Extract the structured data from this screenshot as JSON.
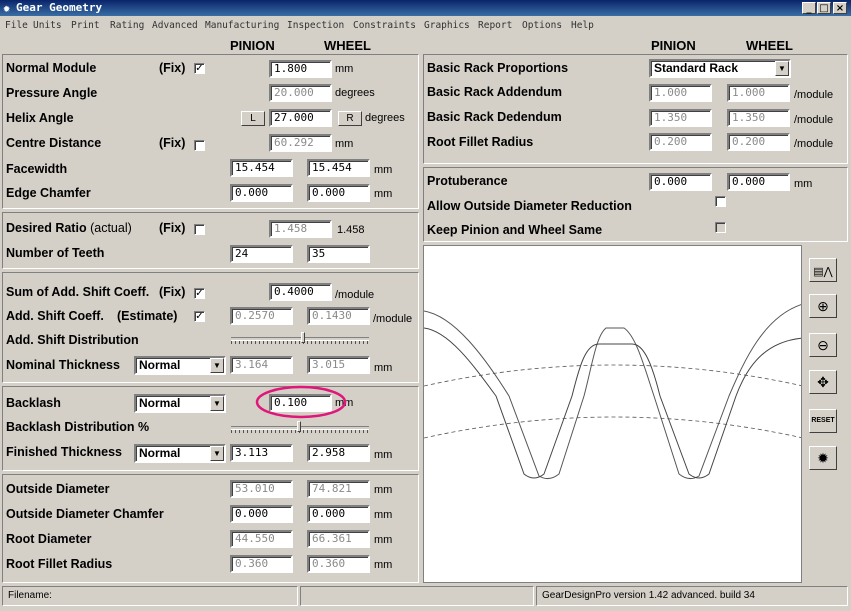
{
  "window": {
    "title": "Gear Geometry",
    "minimize": "_",
    "maximize": "□",
    "close": "×"
  },
  "menu": [
    "File",
    "Units",
    "Print",
    "Rating",
    "Advanced",
    "Manufacturing",
    "Inspection",
    "Constraints",
    "Graphics",
    "Report",
    "Options",
    "Help"
  ],
  "headers": {
    "pinion": "PINION",
    "wheel": "WHEEL"
  },
  "left": {
    "normal_module": {
      "label": "Normal Module",
      "fix": "(Fix)",
      "value": "1.800",
      "unit": "mm"
    },
    "pressure_angle": {
      "label": "Pressure Angle",
      "value": "20.000",
      "unit": "degrees"
    },
    "helix_angle": {
      "label": "Helix Angle",
      "hand_left": "L",
      "value": "27.000",
      "hand_right": "R",
      "unit": "degrees"
    },
    "centre_distance": {
      "label": "Centre Distance",
      "fix": "(Fix)",
      "value": "60.292",
      "unit": "mm"
    },
    "facewidth": {
      "label": "Facewidth",
      "pinion": "15.454",
      "wheel": "15.454",
      "unit": "mm"
    },
    "edge_chamfer": {
      "label": "Edge Chamfer",
      "pinion": "0.000",
      "wheel": "0.000",
      "unit": "mm"
    },
    "desired_ratio": {
      "label": "Desired Ratio",
      "sub": "(actual)",
      "fix": "(Fix)",
      "value": "1.458",
      "actual": "1.458"
    },
    "teeth": {
      "label": "Number of Teeth",
      "pinion": "24",
      "wheel": "35"
    },
    "sum_shift": {
      "label": "Sum of Add. Shift Coeff.",
      "fix": "(Fix)",
      "value": "0.4000",
      "unit": "/module"
    },
    "add_shift": {
      "label": "Add. Shift Coeff.",
      "est": "(Estimate)",
      "pinion": "0.2570",
      "wheel": "0.1430",
      "unit": "/module"
    },
    "shift_dist": {
      "label": "Add. Shift Distribution",
      "position": 0.52
    },
    "nominal_thickness": {
      "label": "Nominal Thickness",
      "select": "Normal",
      "pinion": "3.164",
      "wheel": "3.015",
      "unit": "mm"
    },
    "backlash": {
      "label": "Backlash",
      "select": "Normal",
      "value": "0.100",
      "unit": "mm"
    },
    "backlash_dist": {
      "label": "Backlash Distribution %",
      "position": 0.49
    },
    "finished_thickness": {
      "label": "Finished Thickness",
      "select": "Normal",
      "pinion": "3.113",
      "wheel": "2.958",
      "unit": "mm"
    },
    "outside_diameter": {
      "label": "Outside Diameter",
      "pinion": "53.010",
      "wheel": "74.821",
      "unit": "mm"
    },
    "od_chamfer": {
      "label": "Outside Diameter Chamfer",
      "pinion": "0.000",
      "wheel": "0.000",
      "unit": "mm"
    },
    "root_diameter": {
      "label": "Root Diameter",
      "pinion": "44.550",
      "wheel": "66.361",
      "unit": "mm"
    },
    "root_fillet": {
      "label": "Root Fillet Radius",
      "pinion": "0.360",
      "wheel": "0.360",
      "unit": "mm"
    }
  },
  "right": {
    "rack_proportions": {
      "label": "Basic Rack Proportions",
      "select": "Standard Rack"
    },
    "rack_addendum": {
      "label": "Basic Rack Addendum",
      "pinion": "1.000",
      "wheel": "1.000",
      "unit": "/module"
    },
    "rack_dedendum": {
      "label": "Basic Rack Dedendum",
      "pinion": "1.350",
      "wheel": "1.350",
      "unit": "/module"
    },
    "root_fillet": {
      "label": "Root Fillet Radius",
      "pinion": "0.200",
      "wheel": "0.200",
      "unit": "/module"
    },
    "protuberance": {
      "label": "Protuberance",
      "pinion": "0.000",
      "wheel": "0.000",
      "unit": "mm"
    },
    "allow_od_reduction": {
      "label": "Allow Outside Diameter Reduction"
    },
    "keep_same": {
      "label": "Keep Pinion and Wheel Same"
    }
  },
  "toolbar": {
    "reset": "RESET"
  },
  "status": {
    "filename": "Filename:",
    "version": "GearDesignPro version 1.42 advanced. build 34"
  },
  "colors": {
    "face": "#d4d0c8",
    "title_start": "#0a246a",
    "title_end": "#3a6ea5",
    "annotation": "#e0177a"
  }
}
